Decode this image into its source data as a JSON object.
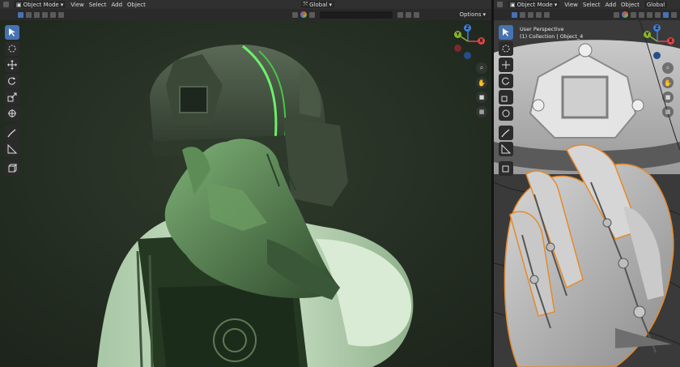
{
  "left_header": {
    "mode_label": "Object Mode",
    "menus": [
      "View",
      "Select",
      "Add",
      "Object"
    ],
    "transform_orientation": "Global",
    "options_label": "Options"
  },
  "right_header": {
    "mode_label": "Object Mode",
    "menus": [
      "View",
      "Select",
      "Add",
      "Object"
    ],
    "transform_orientation": "Global"
  },
  "right_viewport": {
    "view_name": "User Perspective",
    "collection_label": "(1) Collection | Object_4"
  },
  "gizmo_axes": {
    "x": "X",
    "y": "Y",
    "z": "Z"
  },
  "colors": {
    "accent": "#4772b3",
    "axis_x": "#e0464b",
    "axis_y": "#86b62d",
    "axis_z": "#3d80e0",
    "selection_outline": "#e48a2c"
  },
  "tools": [
    "cursor-select-icon",
    "cursor-3d-icon",
    "move-icon",
    "rotate-icon",
    "scale-icon",
    "transform-icon",
    "annotate-icon",
    "measure-icon",
    "add-cube-icon"
  ]
}
